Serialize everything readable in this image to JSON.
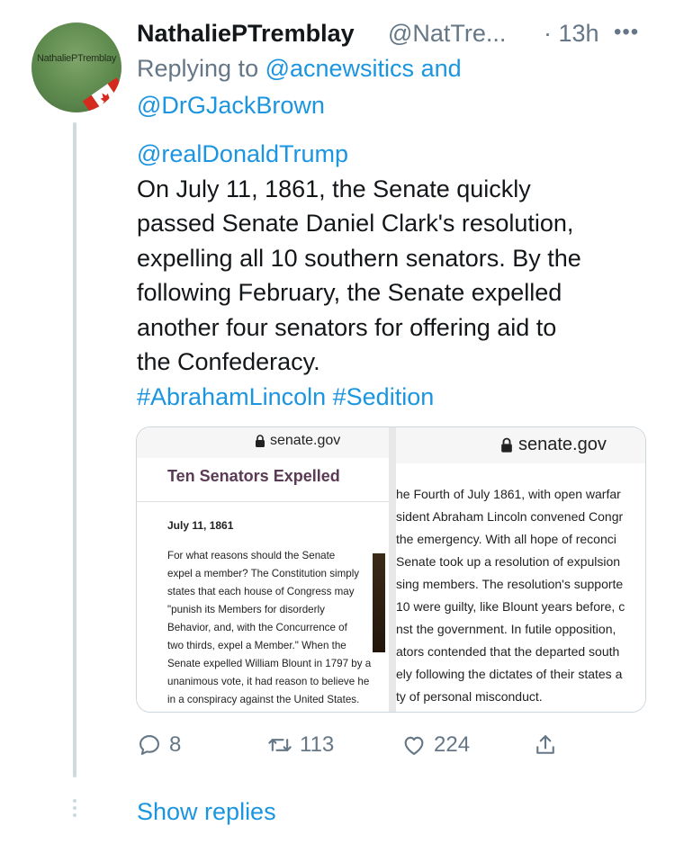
{
  "avatar": {
    "text": "NathaliePTremblay",
    "icon": "canada-flag-icon"
  },
  "tweet": {
    "display_name": "NathaliePTremblay",
    "handle": "@NatTre...",
    "time": "· 13h",
    "more": "•••",
    "replying_prefix": "Replying to ",
    "replying_to": [
      "@acnewsitics",
      "@DrGJackBrown"
    ],
    "replying_and": " and",
    "mention": "@realDonaldTrump",
    "text_lines": [
      "On July 11, 1861, the Senate quickly",
      "passed Senate Daniel Clark's resolution,",
      "expelling all 10 southern senators. By the",
      "following February, the Senate expelled",
      "another four senators for offering aid to",
      "the Confederacy."
    ],
    "hashtags": "#AbrahamLincoln #Sedition"
  },
  "card": {
    "left": {
      "url": "senate.gov",
      "title": "Ten Senators Expelled",
      "date": "July 11, 1861",
      "body_lines": [
        "For what reasons should the Senate",
        "expel a member? The Constitution simply",
        "states that each house of Congress may",
        "\"punish its Members for disorderly",
        "Behavior, and, with the Concurrence of",
        "two thirds, expel a Member.\" When the",
        "Senate expelled William Blount in 1797 by a",
        "unanimous vote, it had reason to believe he",
        "in a conspiracy against the United States."
      ]
    },
    "right": {
      "url": "senate.gov",
      "lines": [
        "he Fourth of July 1861, with open warfar",
        "sident Abraham Lincoln convened Congr",
        "the emergency. With all hope of reconci",
        "Senate took up a resolution of expulsion",
        "sing members. The resolution's supporte",
        "10 were guilty, like Blount years before, c",
        "nst the government. In futile opposition,",
        "ators contended that the departed south",
        "ely following the dictates of their states a",
        "ty of personal misconduct."
      ]
    }
  },
  "actions": {
    "reply_count": "8",
    "retweet_count": "113",
    "like_count": "224"
  },
  "show_replies": "Show replies",
  "colors": {
    "link": "#1b95e0",
    "muted": "#657786",
    "text": "#14171a",
    "thread": "#cfd9de"
  }
}
